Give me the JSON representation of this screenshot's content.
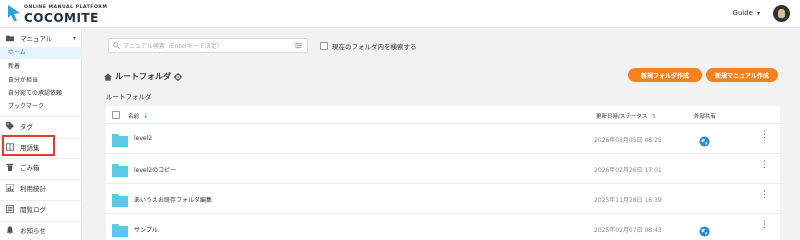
{
  "header": {
    "tagline": "ONLINE MANUAL PLATFORM",
    "brand": "COCOMITE",
    "guide_label": "Guide"
  },
  "sidebar": {
    "manual": "マニュアル",
    "sub_items": [
      "ホーム",
      "新着",
      "自分が担当",
      "自分宛ての承認依頼",
      "ブックマーク"
    ],
    "tags": "タグ",
    "glossary": "用語集",
    "trash": "ごみ箱",
    "stats": "利用統計",
    "history": "閲覧ログ",
    "news": "お知らせ"
  },
  "search": {
    "placeholder": "マニュアル検索（Enterキーで決定）",
    "scope_label": "現在のフォルダ内を検索する"
  },
  "folder": {
    "title": "ルートフォルダ",
    "breadcrumb": "ルートフォルダ",
    "new_folder": "新規フォルダ作成",
    "new_manual": "新規マニュアル作成"
  },
  "table": {
    "col_name": "名前",
    "col_updated": "更新日時/ステータス",
    "col_external": "外部共有",
    "rows": [
      {
        "name": "level2",
        "date": "2026年03月05日 08:25",
        "shared": true
      },
      {
        "name": "level2のコピー",
        "date": "2026年02月26日 17:01",
        "shared": false
      },
      {
        "name": "あいうえお既存フォルダ編集",
        "date": "2025年11月28日 16:39",
        "shared": false
      },
      {
        "name": "サンプル",
        "date": "2025年02月07日 08:43",
        "shared": true
      }
    ]
  },
  "colors": {
    "accent": "#f5821f",
    "link": "#2a8ad4",
    "folder": "#5bc8e6",
    "highlight": "#e03a3a"
  }
}
